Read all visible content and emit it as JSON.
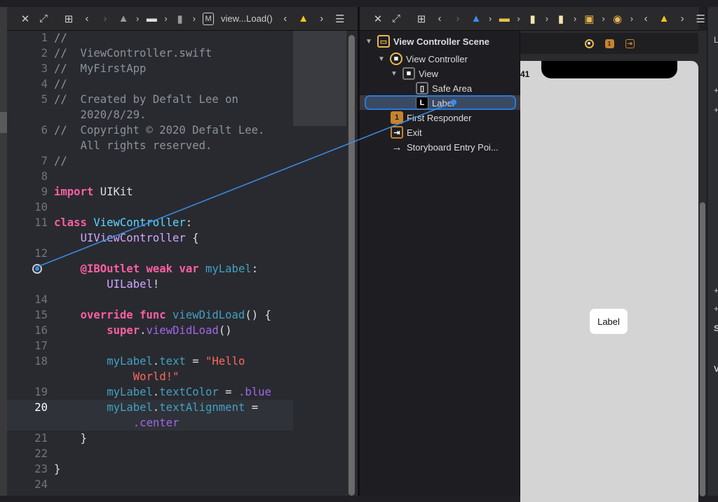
{
  "left_toolbar": {
    "icons": [
      "close-icon",
      "expand-icon",
      "related-items-icon",
      "back-icon",
      "forward-icon",
      "project-icon",
      "folder-icon",
      "swift-file-icon",
      "method-icon"
    ],
    "breadcrumb_method": "M",
    "breadcrumb_label": "view...Load()",
    "warning_icon": "warning-icon"
  },
  "right_toolbar": {
    "icons": [
      "close-icon",
      "expand-icon",
      "related-items-icon",
      "back-icon",
      "forward-icon",
      "project-icon",
      "folder-icon",
      "storyboard-icon",
      "storyboard-icon",
      "scene-icon",
      "view-controller-icon",
      "warning-icon"
    ]
  },
  "editor": {
    "current_line": "20",
    "rows": [
      {
        "n": "1",
        "ind": 0,
        "seg": [
          [
            "//",
            "comment"
          ]
        ]
      },
      {
        "n": "2",
        "ind": 0,
        "seg": [
          [
            "//  ViewController.swift",
            "comment"
          ]
        ]
      },
      {
        "n": "3",
        "ind": 0,
        "seg": [
          [
            "//  MyFirstApp",
            "comment"
          ]
        ]
      },
      {
        "n": "4",
        "ind": 0,
        "seg": [
          [
            "//",
            "comment"
          ]
        ]
      },
      {
        "n": "5",
        "ind": 0,
        "seg": [
          [
            "//  Created by Defalt Lee on",
            "comment"
          ]
        ]
      },
      {
        "n": "",
        "ind": 4,
        "seg": [
          [
            "2020/8/29.",
            "comment"
          ]
        ]
      },
      {
        "n": "6",
        "ind": 0,
        "seg": [
          [
            "//  Copyright © 2020 Defalt Lee.",
            "comment"
          ]
        ]
      },
      {
        "n": "",
        "ind": 4,
        "seg": [
          [
            "All rights reserved.",
            "comment"
          ]
        ]
      },
      {
        "n": "7",
        "ind": 0,
        "seg": [
          [
            "//",
            "comment"
          ]
        ]
      },
      {
        "n": "8",
        "ind": 0,
        "seg": []
      },
      {
        "n": "9",
        "ind": 0,
        "seg": [
          [
            "import",
            "kw"
          ],
          [
            " UIKit",
            "plain"
          ]
        ]
      },
      {
        "n": "10",
        "ind": 0,
        "seg": []
      },
      {
        "n": "11",
        "ind": 0,
        "seg": [
          [
            "class",
            "kw"
          ],
          [
            " ",
            "plain"
          ],
          [
            "ViewController",
            "decl"
          ],
          [
            ":",
            "plain"
          ]
        ]
      },
      {
        "n": "",
        "ind": 4,
        "seg": [
          [
            "UIViewController",
            "type"
          ],
          [
            " {",
            "plain"
          ]
        ]
      },
      {
        "n": "12",
        "ind": 0,
        "seg": []
      },
      {
        "n": "",
        "outlet": true,
        "ind": 4,
        "seg": [
          [
            "@IBOutlet",
            "kw"
          ],
          [
            " ",
            "plain"
          ],
          [
            "weak",
            "kw"
          ],
          [
            " ",
            "plain"
          ],
          [
            "var",
            "kw"
          ],
          [
            " ",
            "plain"
          ],
          [
            "myLabel",
            "prop"
          ],
          [
            ":",
            "plain"
          ]
        ]
      },
      {
        "n": "",
        "ind": 8,
        "seg": [
          [
            "UILabel",
            "type"
          ],
          [
            "!",
            "plain"
          ]
        ]
      },
      {
        "n": "14",
        "ind": 0,
        "seg": []
      },
      {
        "n": "15",
        "ind": 4,
        "seg": [
          [
            "override",
            "kw"
          ],
          [
            " ",
            "plain"
          ],
          [
            "func",
            "kw"
          ],
          [
            " ",
            "plain"
          ],
          [
            "viewDidLoad",
            "prop"
          ],
          [
            "() {",
            "plain"
          ]
        ]
      },
      {
        "n": "16",
        "ind": 8,
        "seg": [
          [
            "super",
            "kw"
          ],
          [
            ".",
            "plain"
          ],
          [
            "viewDidLoad",
            "fn"
          ],
          [
            "()",
            "plain"
          ]
        ]
      },
      {
        "n": "17",
        "ind": 0,
        "seg": []
      },
      {
        "n": "18",
        "ind": 8,
        "seg": [
          [
            "myLabel",
            "prop"
          ],
          [
            ".",
            "plain"
          ],
          [
            "text",
            "prop"
          ],
          [
            " = ",
            "plain"
          ],
          [
            "\"Hello",
            "str"
          ]
        ]
      },
      {
        "n": "",
        "ind": 12,
        "seg": [
          [
            "World!\"",
            "str"
          ]
        ]
      },
      {
        "n": "19",
        "ind": 8,
        "seg": [
          [
            "myLabel",
            "prop"
          ],
          [
            ".",
            "plain"
          ],
          [
            "textColor",
            "prop"
          ],
          [
            " = ",
            "plain"
          ],
          [
            ".blue",
            "fn"
          ]
        ]
      },
      {
        "n": "20",
        "ind": 8,
        "cur": true,
        "seg": [
          [
            "myLabel",
            "prop"
          ],
          [
            ".",
            "plain"
          ],
          [
            "textAlignment",
            "prop"
          ],
          [
            " =",
            "plain"
          ]
        ]
      },
      {
        "n": "",
        "ind": 12,
        "cur": true,
        "seg": [
          [
            ".center",
            "fn"
          ]
        ]
      },
      {
        "n": "21",
        "ind": 4,
        "seg": [
          [
            "}",
            "plain"
          ]
        ]
      },
      {
        "n": "22",
        "ind": 0,
        "seg": []
      },
      {
        "n": "23",
        "ind": 0,
        "seg": [
          [
            "}",
            "plain"
          ]
        ]
      },
      {
        "n": "24",
        "ind": 0,
        "seg": []
      }
    ]
  },
  "outline": {
    "scene": "View Controller Scene",
    "view_controller": "View Controller",
    "view": "View",
    "safe_area": "Safe Area",
    "label": "Label",
    "first_responder": "First Responder",
    "exit": "Exit",
    "entry_point": "Storyboard Entry Poi..."
  },
  "canvas": {
    "status_time": "41",
    "label_text": "Label"
  },
  "inspector": {
    "letters": [
      "L",
      "+",
      "+",
      "+",
      "+",
      "S",
      "V"
    ]
  },
  "colors": {
    "accent": "#2a79d8",
    "keyword": "#fc5fa3",
    "comment": "#8b939c",
    "string": "#fc6a5d",
    "warning": "#f5c518"
  }
}
